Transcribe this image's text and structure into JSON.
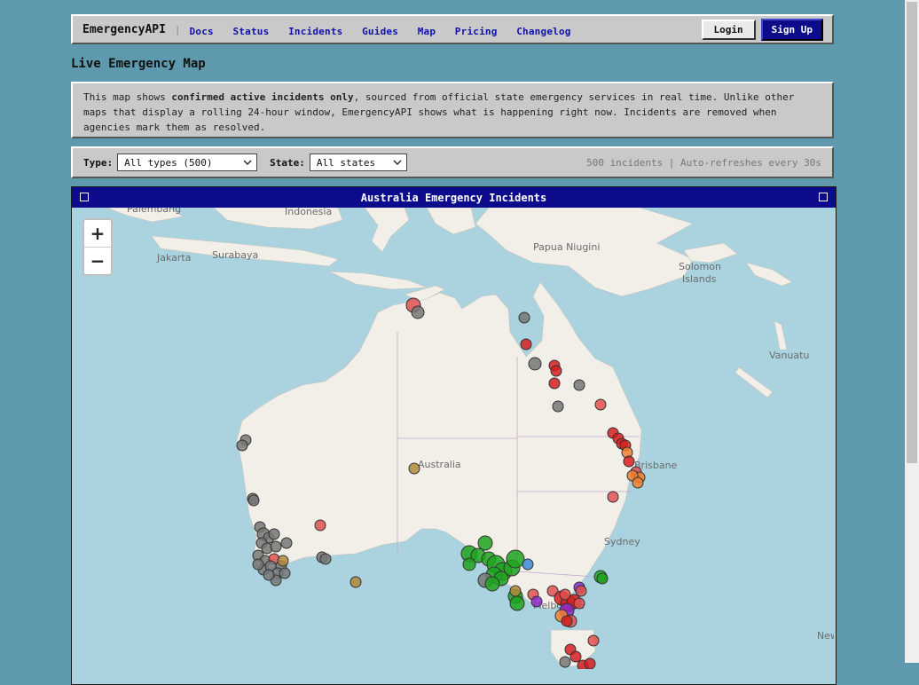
{
  "nav": {
    "brand": "EmergencyAPI",
    "separator": "|",
    "links": [
      "Docs",
      "Status",
      "Incidents",
      "Guides",
      "Map",
      "Pricing",
      "Changelog"
    ],
    "login_label": "Login",
    "signup_label": "Sign Up"
  },
  "page_title": "Live Emergency Map",
  "notice": {
    "part1": "This map shows ",
    "bold": "confirmed active incidents only",
    "part2": ", sourced from official state emergency services in real time. Unlike other maps that display a rolling 24-hour window, EmergencyAPI shows what is happening right now. Incidents are removed when agencies mark them as resolved."
  },
  "filters": {
    "type_label": "Type:",
    "type_value": "All types (500)",
    "state_label": "State:",
    "state_value": "All states",
    "count_text": "500 incidents | Auto-refreshes every 30s"
  },
  "map": {
    "title": "Australia Emergency Incidents",
    "zoom_in": "+",
    "zoom_out": "−",
    "labels": [
      "Palembang",
      "Indonesia",
      "Jakarta",
      "Surabaya",
      "Papua Niugini",
      "Solomon",
      "Islands",
      "Vanuatu",
      "Australia",
      "Brisbane",
      "Sydney",
      "Melbourne",
      "New"
    ],
    "colors": {
      "water": "#aad3df",
      "land": "#f2efe9",
      "red": "#d42020",
      "red_light": "#e05050",
      "grey": "#777777",
      "green": "#1fa31f",
      "orange": "#f08030",
      "purple": "#8a2bc8",
      "olive": "#b08a3a",
      "blue": "#3a8ad8"
    }
  }
}
